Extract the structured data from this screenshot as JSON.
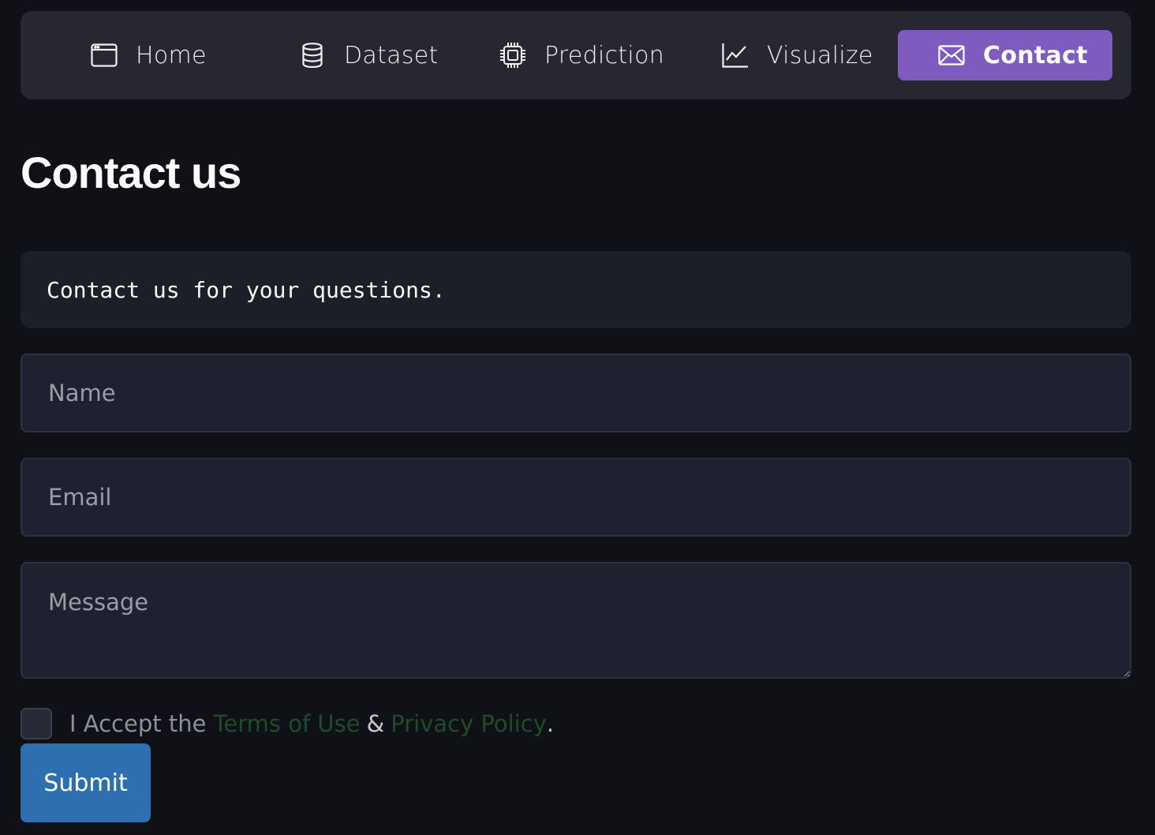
{
  "nav": {
    "items": [
      {
        "label": "Home",
        "icon": "window-icon"
      },
      {
        "label": "Dataset",
        "icon": "database-icon"
      },
      {
        "label": "Prediction",
        "icon": "cpu-chip-icon"
      },
      {
        "label": "Visualize",
        "icon": "line-chart-icon"
      },
      {
        "label": "Contact",
        "icon": "envelope-icon",
        "active": true
      }
    ],
    "active_color": "#7d5bbf"
  },
  "page": {
    "title": "Contact us",
    "info_text": "Contact us for your questions."
  },
  "form": {
    "name_placeholder": "Name",
    "email_placeholder": "Email",
    "message_placeholder": "Message",
    "accept_prefix": "I Accept the",
    "terms_link": "Terms of Use",
    "amp": "&",
    "privacy_link": "Privacy Policy",
    "period": ".",
    "accepted": false,
    "submit_label": "Submit",
    "submit_color": "#2e6fb0"
  }
}
